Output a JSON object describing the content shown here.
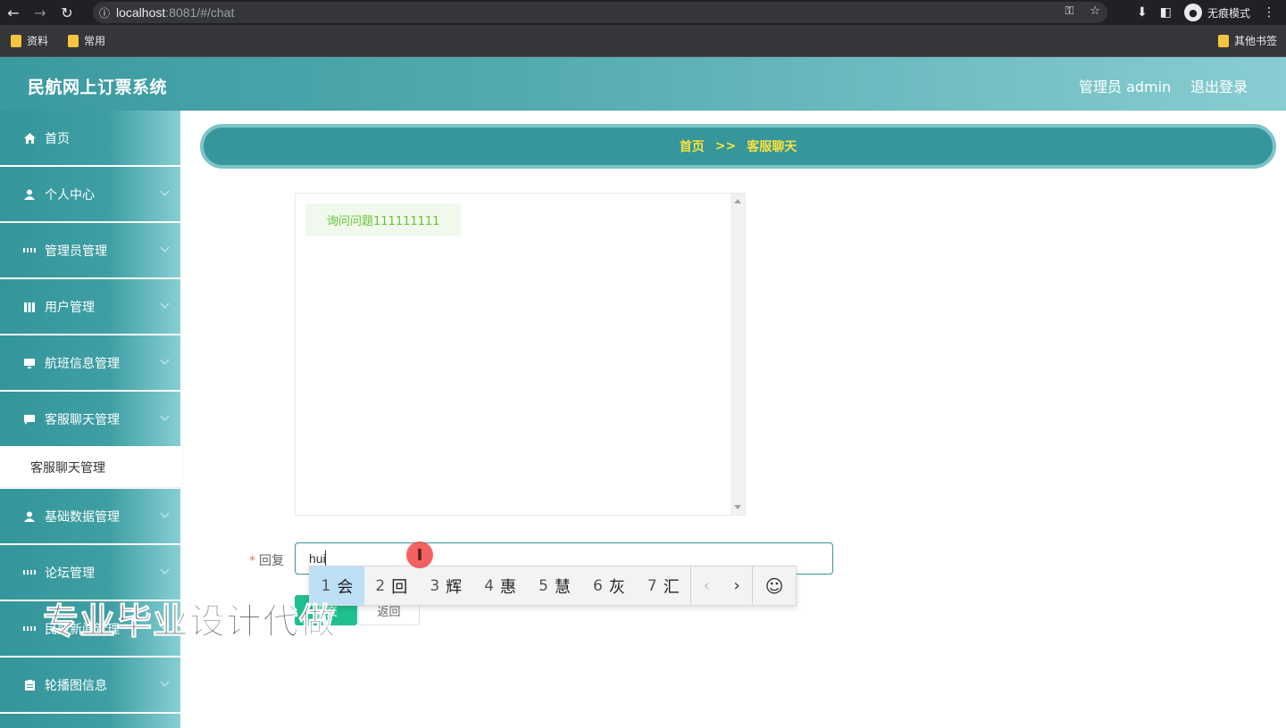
{
  "browser": {
    "url_host": "localhost",
    "url_path": ":8081/#/chat",
    "incognito_label": "无痕模式",
    "bookmarks": [
      "资料",
      "常用"
    ],
    "other_bookmarks": "其他书签"
  },
  "header": {
    "title": "民航网上订票系统",
    "user": "管理员 admin",
    "logout": "退出登录"
  },
  "sidebar": {
    "items": [
      {
        "label": "首页",
        "icon": "home-icon"
      },
      {
        "label": "个人中心",
        "icon": "user-icon"
      },
      {
        "label": "管理员管理",
        "icon": "grid-icon"
      },
      {
        "label": "用户管理",
        "icon": "bars-icon"
      },
      {
        "label": "航班信息管理",
        "icon": "monitor-icon"
      },
      {
        "label": "客服聊天管理",
        "icon": "chat-icon"
      },
      {
        "label": "基础数据管理",
        "icon": "user-icon"
      },
      {
        "label": "论坛管理",
        "icon": "grid-icon"
      },
      {
        "label": "民航新闻管理",
        "icon": "grid-icon"
      },
      {
        "label": "轮播图信息",
        "icon": "clipboard-icon"
      }
    ],
    "active_sub": "客服聊天管理"
  },
  "breadcrumb": {
    "home": "首页",
    "sep": ">>",
    "current": "客服聊天"
  },
  "chat": {
    "messages": [
      "询问问题111111111"
    ]
  },
  "form": {
    "reply_label": "回复",
    "required_mark": "*",
    "reply_value": "hui",
    "submit_label": "提交",
    "back_label": "返回"
  },
  "ime": {
    "candidates": [
      {
        "n": "1",
        "c": "会"
      },
      {
        "n": "2",
        "c": "回"
      },
      {
        "n": "3",
        "c": "辉"
      },
      {
        "n": "4",
        "c": "惠"
      },
      {
        "n": "5",
        "c": "慧"
      },
      {
        "n": "6",
        "c": "灰"
      },
      {
        "n": "7",
        "c": "汇"
      }
    ]
  },
  "watermark": "专业毕业设计代做",
  "colors": {
    "primary": "#36969b",
    "breadcrumb_text": "#f7e23c",
    "submit": "#1fbf8f",
    "message_bg": "#f0f9eb",
    "message_text": "#67c23a"
  }
}
